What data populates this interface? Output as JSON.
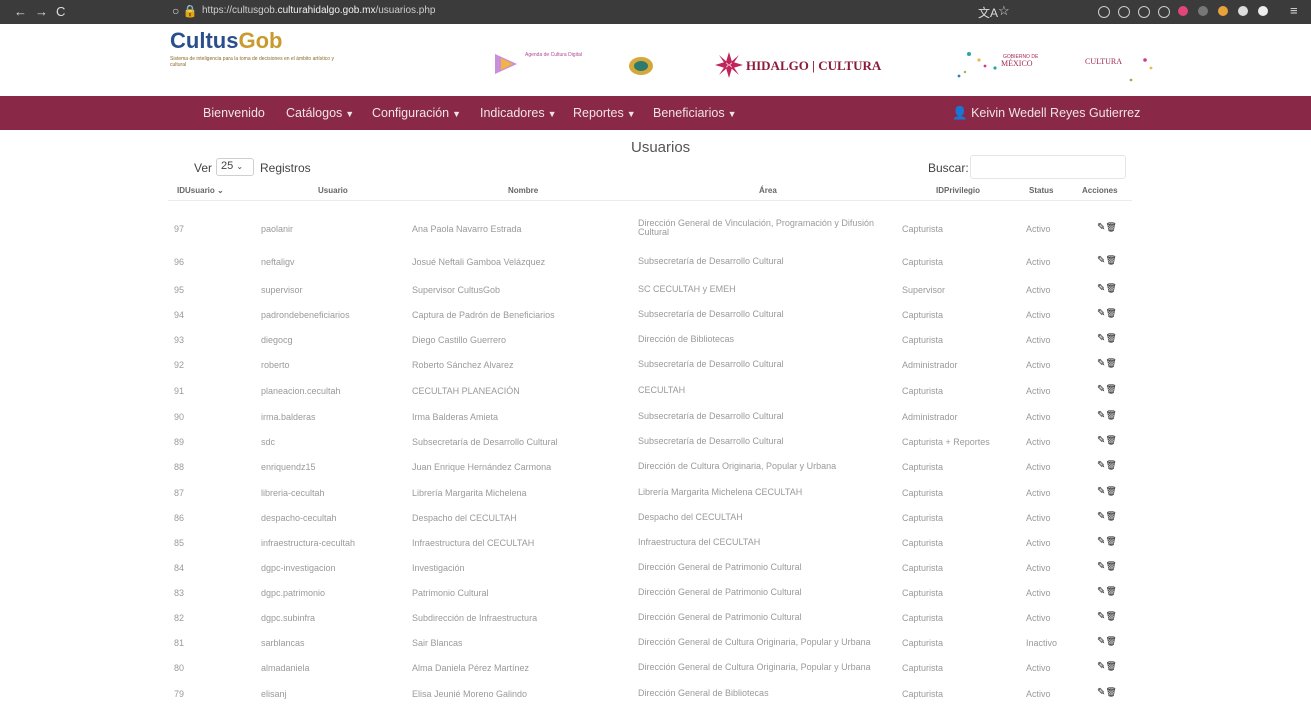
{
  "browser": {
    "url_prefix": "https://cultusgob.",
    "url_domain": "culturahidalgo.gob.mx",
    "url_path": "/usuarios.php"
  },
  "header": {
    "logo_main": "Cultus",
    "logo_accent": "Gob",
    "logo_sub": "Sistema de inteligencia para la toma de decisiones en el ámbito artístico y cultural",
    "agenda_text": "Agenda de Cultura Digital",
    "hidalgo_text": "HIDALGO | CULTURA",
    "gob_label": "GOBIERNO DE",
    "mexico_label": "MÉXICO",
    "cultura_label": "CULTURA"
  },
  "navbar": {
    "items": [
      "Bienvenido",
      "Catálogos",
      "Configuración",
      "Indicadores",
      "Reportes",
      "Beneficiarios"
    ],
    "user": "Keivin Wedell Reyes Gutierrez",
    "bg_color": "#8a2847"
  },
  "page": {
    "title": "Usuarios",
    "ver_label": "Ver",
    "page_size": "25",
    "registros_label": "Registros",
    "buscar_label": "Buscar:"
  },
  "table": {
    "headers": [
      "IDUsuario",
      "Usuario",
      "Nombre",
      "Área",
      "IDPrivilegio",
      "Status",
      "Acciones"
    ],
    "rows": [
      {
        "id": "97",
        "usuario": "paolanir",
        "nombre": "Ana Paola Navarro Estrada",
        "area": "Dirección General de Vinculación, Programación y Difusión Cultural",
        "privilegio": "Capturista",
        "status": "Activo"
      },
      {
        "id": "96",
        "usuario": "neftaligv",
        "nombre": "Josué Neftali Gamboa Velázquez",
        "area": "Subsecretaría de Desarrollo Cultural",
        "privilegio": "Capturista",
        "status": "Activo"
      },
      {
        "id": "95",
        "usuario": "supervisor",
        "nombre": "Supervisor CultusGob",
        "area": "SC CECULTAH y EMEH",
        "privilegio": "Supervisor",
        "status": "Activo"
      },
      {
        "id": "94",
        "usuario": "padrondebeneficiarios",
        "nombre": "Captura de Padrón de Beneficiarios",
        "area": "Subsecretaría de Desarrollo Cultural",
        "privilegio": "Capturista",
        "status": "Activo"
      },
      {
        "id": "93",
        "usuario": "diegocg",
        "nombre": "Diego Castillo Guerrero",
        "area": "Dirección de Bibliotecas",
        "privilegio": "Capturista",
        "status": "Activo"
      },
      {
        "id": "92",
        "usuario": "roberto",
        "nombre": "Roberto Sánchez Alvarez",
        "area": "Subsecretaría de Desarrollo Cultural",
        "privilegio": "Administrador",
        "status": "Activo"
      },
      {
        "id": "91",
        "usuario": "planeacion.cecultah",
        "nombre": "CECULTAH PLANEACIÓN",
        "area": "CECULTAH",
        "privilegio": "Capturista",
        "status": "Activo"
      },
      {
        "id": "90",
        "usuario": "irma.balderas",
        "nombre": "Irma Balderas Amieta",
        "area": "Subsecretaría de Desarrollo Cultural",
        "privilegio": "Administrador",
        "status": "Activo"
      },
      {
        "id": "89",
        "usuario": "sdc",
        "nombre": "Subsecretaría de Desarrollo Cultural",
        "area": "Subsecretaría de Desarrollo Cultural",
        "privilegio": "Capturista + Reportes",
        "status": "Activo"
      },
      {
        "id": "88",
        "usuario": "enriquendz15",
        "nombre": "Juan Enrique Hernández Carmona",
        "area": "Dirección de Cultura Originaria, Popular y Urbana",
        "privilegio": "Capturista",
        "status": "Activo"
      },
      {
        "id": "87",
        "usuario": "libreria-cecultah",
        "nombre": "Librería Margarita Michelena",
        "area": "Librería Margarita Michelena CECULTAH",
        "privilegio": "Capturista",
        "status": "Activo"
      },
      {
        "id": "86",
        "usuario": "despacho-cecultah",
        "nombre": "Despacho del CECULTAH",
        "area": "Despacho del CECULTAH",
        "privilegio": "Capturista",
        "status": "Activo"
      },
      {
        "id": "85",
        "usuario": "infraestructura-cecultah",
        "nombre": "Infraestructura del CECULTAH",
        "area": "Infraestructura del CECULTAH",
        "privilegio": "Capturista",
        "status": "Activo"
      },
      {
        "id": "84",
        "usuario": "dgpc-investigacion",
        "nombre": "Investigación",
        "area": "Dirección General de Patrimonio Cultural",
        "privilegio": "Capturista",
        "status": "Activo"
      },
      {
        "id": "83",
        "usuario": "dgpc.patrimonio",
        "nombre": "Patrimonio Cultural",
        "area": "Dirección General de Patrimonio Cultural",
        "privilegio": "Capturista",
        "status": "Activo"
      },
      {
        "id": "82",
        "usuario": "dgpc.subinfra",
        "nombre": "Subdirección de Infraestructura",
        "area": "Dirección General de Patrimonio Cultural",
        "privilegio": "Capturista",
        "status": "Activo"
      },
      {
        "id": "81",
        "usuario": "sarblancas",
        "nombre": "Sair Blancas",
        "area": "Dirección General de Cultura Originaria, Popular y Urbana",
        "privilegio": "Capturista",
        "status": "Inactivo"
      },
      {
        "id": "80",
        "usuario": "almadaniela",
        "nombre": "Alma Daniela Pérez Martínez",
        "area": "Dirección General de Cultura Originaria, Popular y Urbana",
        "privilegio": "Capturista",
        "status": "Activo"
      },
      {
        "id": "79",
        "usuario": "elisanj",
        "nombre": "Elisa Jeunié Moreno Galindo",
        "area": "Dirección General de Bibliotecas",
        "privilegio": "Capturista",
        "status": "Activo"
      }
    ]
  }
}
